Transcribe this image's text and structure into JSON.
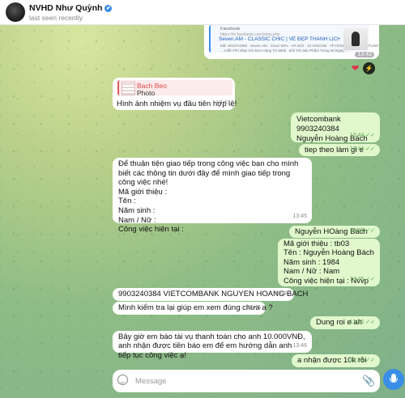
{
  "header": {
    "title": "NVHD Như Quỳnh",
    "status": "last seen recently",
    "verified_icon": "✔"
  },
  "link_preview": {
    "source": "Facebook",
    "url": "https://m.facebook.com/story.php",
    "title": "Seven.AM - CLASSIC CHIC | VẺ ĐẸP THANH LỊCH ...",
    "desc1": "Mã: HIGHY4960 · Seven.AM · SALE 50% · HÀ NỘI · 13 VINCOM · TP.HCM · LH ZALO/HOTLINE",
    "desc2": "... miễn Phí Ship Với Đơn Hàng Từ 600k · Đổi Trả Sản Phẩm Trong 30 Ngày ...",
    "time": "13:42"
  },
  "reactions": {
    "heart": "❤",
    "action_icon": "⚡"
  },
  "messages": [
    {
      "side": "in",
      "reply_name": "Bach Beo",
      "reply_type": "Photo",
      "text": "Hình ảnh nhiệm vụ đầu tiên hợp lệ!",
      "time": "13:43"
    },
    {
      "side": "out",
      "text": "Vietcombank\n9903240384\nNguyễn Hoàng Bách",
      "time": "13:44"
    },
    {
      "side": "out",
      "text": "tiep theo làm gì e",
      "time": "13:44"
    },
    {
      "side": "in",
      "text": "Để thuận tiện giao tiếp trong công việc bạn cho mình biết các thông tin dưới đây để mình giao tiếp trong công việc nhé!\nMã giới thiệu :\nTên :\nNăm sinh :\nNam / Nữ :\nCông việc hiện tại :",
      "time": "13:45"
    },
    {
      "side": "out",
      "text": "Nguyễn HOàng Bách",
      "time": "13:45"
    },
    {
      "side": "out",
      "text": "Mã giới thiệu : tb03\nTên : Nguyễn Hoàng Bách\nNăm sinh :    1984\nNam / Nữ : Nam\nCông việc hiện tại : Nvvp",
      "time": "13:45"
    },
    {
      "side": "in",
      "text": "9903240384  VIETCOMBANK  NGUYEN HOANG BACH",
      "time": "13:46"
    },
    {
      "side": "in",
      "text": "Mình kiểm tra lại giúp em xem đúng chưa ạ ?",
      "time": "13:46"
    },
    {
      "side": "out",
      "text": "Dung roi e ah",
      "time": "13:46"
    },
    {
      "side": "in",
      "text": "Bây giờ em báo tài vụ thanh toán cho anh 10.000VNĐ, anh nhận được tiền báo em để em hướng dẫn anh tiếp tục công việc ạ!",
      "time": "13:46"
    },
    {
      "side": "out",
      "text": "a nhận được 10k rồi",
      "time": "13:53"
    }
  ],
  "input": {
    "placeholder": "Message",
    "attach_icon": "📎"
  },
  "colors": {
    "incoming": "#ffffff",
    "outgoing": "#e0f8cc",
    "accent": "#3a8ee6",
    "reply_name": "#d94b4b"
  }
}
